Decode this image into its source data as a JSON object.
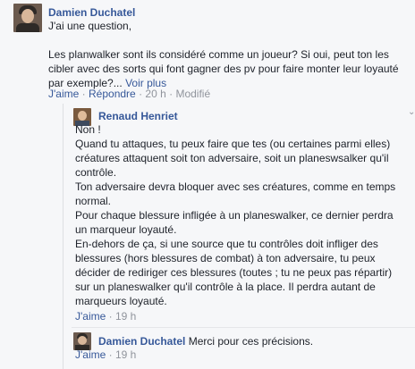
{
  "comment1": {
    "author": "Damien Duchatel",
    "lines": [
      "J'ai une question,",
      "",
      "Les planwalker sont ils considéré comme un joueur? Si oui, peut ton les",
      "cibler avec des sorts qui font gagner des pv pour faire monter leur loyauté",
      "par exemple?..."
    ],
    "see_more": "Voir plus",
    "like": "J'aime",
    "sep": "·",
    "reply": "Répondre",
    "time": "20 h",
    "edited": "Modifié"
  },
  "reply1": {
    "author": "Renaud Henriet",
    "lines": [
      "Non !",
      "Quand tu attaques, tu peux faire que tes (ou certaines parmi elles)",
      "créatures attaquent soit ton adversaire, soit un planeswsalker qu'il",
      "contrôle.",
      "Ton adversaire devra bloquer avec ses créatures, comme en temps",
      "normal.",
      "Pour chaque blessure infligée à un planeswalker, ce dernier perdra",
      "un marqueur loyauté.",
      "En-dehors de ça, si une source que tu contrôles doit infliger des",
      "blessures (hors blessures de combat) à ton adversaire, tu peux",
      "décider de rediriger ces blessures (toutes ; tu ne peux pas répartir)",
      "sur un planeswalker qu'il contrôle à la place. Il perdra autant de",
      "marqueurs loyauté."
    ],
    "like": "J'aime",
    "sep": "·",
    "time": "19 h"
  },
  "reply2": {
    "author": "Damien Duchatel",
    "text": "Merci pour ces précisions.",
    "like": "J'aime",
    "sep": "·",
    "time": "19 h"
  },
  "icons": {
    "options": "chevron-down-icon"
  }
}
